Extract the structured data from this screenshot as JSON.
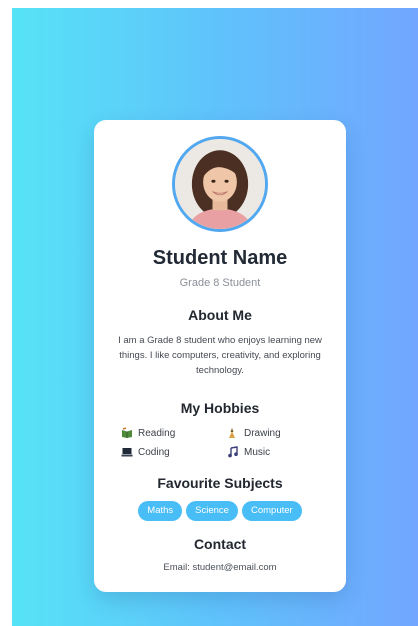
{
  "profile": {
    "name": "Student Name",
    "grade": "Grade 8 Student"
  },
  "about": {
    "title": "About Me",
    "text": "I am a Grade 8 student who enjoys learning new things. I like computers, creativity, and exploring technology."
  },
  "hobbies": {
    "title": "My Hobbies",
    "items": [
      {
        "label": "Reading",
        "icon": "book-icon"
      },
      {
        "label": "Drawing",
        "icon": "paint-icon"
      },
      {
        "label": "Coding",
        "icon": "laptop-icon"
      },
      {
        "label": "Music",
        "icon": "music-note-icon"
      }
    ]
  },
  "subjects": {
    "title": "Favourite Subjects",
    "items": [
      "Maths",
      "Science",
      "Computer"
    ]
  },
  "contact": {
    "title": "Contact",
    "email": "Email: student@email.com"
  },
  "colors": {
    "accent": "#49bdf5",
    "gradient_start": "#56e3f6",
    "gradient_end": "#72a6ff"
  }
}
